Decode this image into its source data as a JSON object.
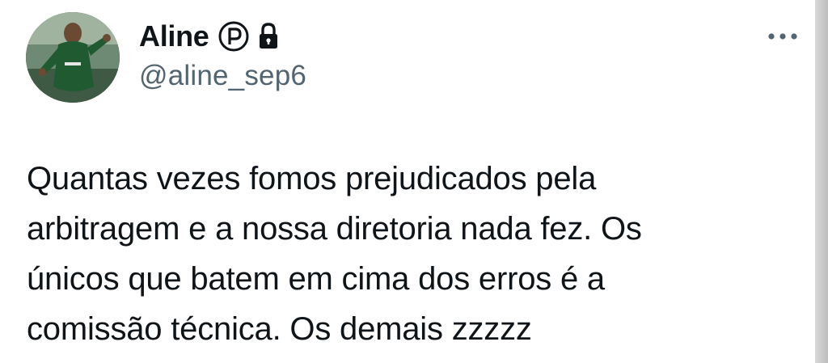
{
  "author": {
    "display_name": "Aline",
    "handle": "@aline_sep6",
    "badge_icon": "circled-p-icon",
    "lock_icon": "lock-icon",
    "avatar": "player-photo-avatar"
  },
  "more_icon": "more-dots-icon",
  "tweet": {
    "lines": [
      "Quantas vezes fomos prejudicados pela",
      "arbitragem e a nossa diretoria nada fez. Os",
      "únicos que batem em cima dos erros é a",
      "comissão técnica. Os demais zzzzz"
    ]
  },
  "colors": {
    "text_primary": "#0f1419",
    "text_secondary": "#536471",
    "background": "#ffffff"
  }
}
